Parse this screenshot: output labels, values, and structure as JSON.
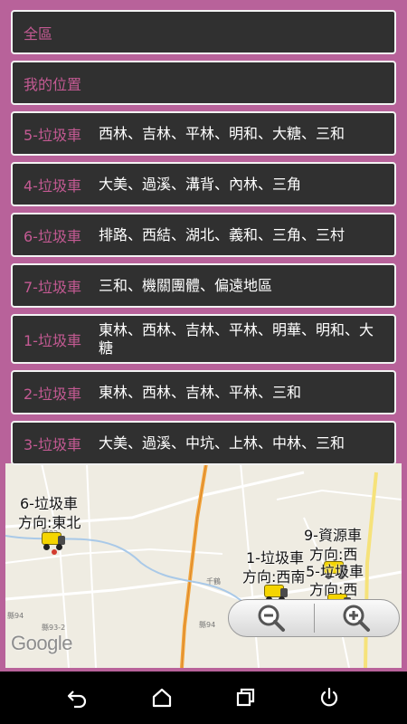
{
  "colors": {
    "background": "#b8629a",
    "item_background": "#303030",
    "item_border": "#f2f2f2",
    "title_accent": "#c45a93",
    "desc_text": "#ffffff",
    "navbar": "#000000"
  },
  "menu": {
    "items": [
      {
        "title": "全區",
        "desc": ""
      },
      {
        "title": "我的位置",
        "desc": ""
      },
      {
        "title": "5-垃圾車",
        "desc": "西林、吉林、平林、明和、大糖、三和"
      },
      {
        "title": "4-垃圾車",
        "desc": "大美、過溪、溝背、內林、三角"
      },
      {
        "title": "6-垃圾車",
        "desc": "排路、西結、湖北、義和、三角、三村"
      },
      {
        "title": "7-垃圾車",
        "desc": "三和、機關團體、偏遠地區"
      },
      {
        "title": "1-垃圾車",
        "desc": "東林、西林、吉林、平林、明華、明和、大糖"
      },
      {
        "title": "2-垃圾車",
        "desc": "東林、西林、吉林、平林、三和"
      },
      {
        "title": "3-垃圾車",
        "desc": "大美、過溪、中坑、上林、中林、三和"
      }
    ]
  },
  "map": {
    "markers": [
      {
        "line1": "6-垃圾車",
        "line2": "方向:東北"
      },
      {
        "line1": "9-資源車",
        "line2": "方向:西"
      },
      {
        "line1": "1-垃圾車",
        "line2": "方向:西南"
      },
      {
        "line1": "5-垃圾車",
        "line2": "方向:西"
      }
    ],
    "road_labels": [
      "縣93",
      "縣94",
      "縣93-2",
      "縣94",
      "千鶴"
    ],
    "logo": "Google",
    "zoom_out_icon": "zoom-out-icon",
    "zoom_in_icon": "zoom-in-icon"
  },
  "navbar": {
    "icons": [
      "back-icon",
      "home-icon",
      "recents-icon",
      "power-icon"
    ]
  }
}
